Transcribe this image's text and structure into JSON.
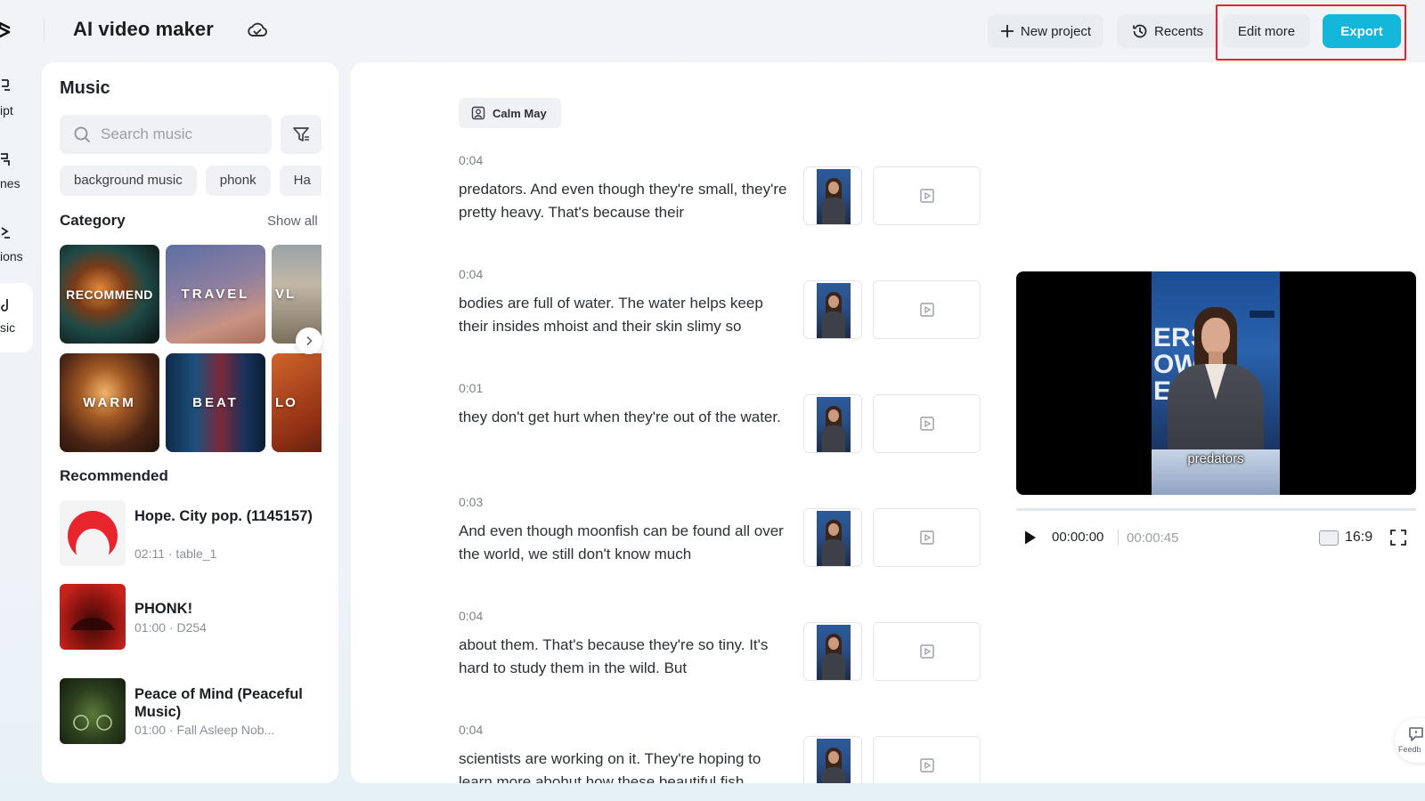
{
  "header": {
    "app_title": "AI video maker",
    "new_project_label": "New project",
    "recents_label": "Recents",
    "edit_more_label": "Edit more",
    "export_label": "Export"
  },
  "rail": {
    "items": [
      {
        "label": "ipt",
        "active": false
      },
      {
        "label": "nes",
        "active": false
      },
      {
        "label": "ions",
        "active": false
      },
      {
        "label": "sic",
        "active": true
      }
    ]
  },
  "music": {
    "title": "Music",
    "search_placeholder": "Search music",
    "chips": [
      "background music",
      "phonk",
      "Ha"
    ],
    "category_title": "Category",
    "show_all_label": "Show all",
    "categories": [
      "RECOMMEND",
      "TRAVEL",
      "VL",
      "WARM",
      "BEAT",
      "LO"
    ],
    "recommended_title": "Recommended",
    "tracks": [
      {
        "name": "Hope. City pop. (1145157)",
        "meta": "02:11 · table_1"
      },
      {
        "name": "PHONK!",
        "meta": "01:00 · D254"
      },
      {
        "name": "Peace of Mind (Peaceful Music)",
        "meta": "01:00 · Fall Asleep Nob..."
      }
    ]
  },
  "script": {
    "voice_label": "Calm May",
    "segments": [
      {
        "duration": "0:04",
        "text": "predators. And even though they're small, they're pretty heavy. That's because their"
      },
      {
        "duration": "0:04",
        "text": "bodies are full of water. The water helps keep their insides mhoist and their skin slimy so"
      },
      {
        "duration": "0:01",
        "text": "they don't get hurt when they're out of the water."
      },
      {
        "duration": "0:03",
        "text": "And even though moonfish can be found all over the world, we still don't know much"
      },
      {
        "duration": "0:04",
        "text": "about them. That's because they're so tiny. It's hard to study them in the wild. But"
      },
      {
        "duration": "0:04",
        "text": "scientists are working on it. They're hoping to learn more abohut how these beautiful fish"
      }
    ]
  },
  "preview": {
    "caption": "predators",
    "backdrop_text": "ERS OWS EN",
    "current_time": "00:00:00",
    "total_time": "00:00:45",
    "aspect_ratio": "16:9",
    "progress": 0
  },
  "feedback_label": "Feedb",
  "colors": {
    "accent": "#12b7d9",
    "highlight": "#e8232e"
  }
}
